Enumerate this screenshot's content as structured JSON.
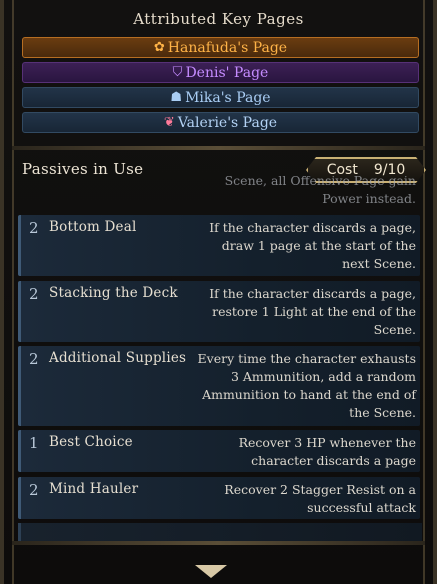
{
  "attributed": {
    "title": "Attributed Key Pages",
    "pages": [
      {
        "name": "Hanafuda's Page",
        "icon": "✿",
        "color": "#ffb347"
      },
      {
        "name": "Denis' Page",
        "icon": "⛉",
        "color": "#c58cff"
      },
      {
        "name": "Mika's Page",
        "icon": "☗",
        "color": "#a9cdf4"
      },
      {
        "name": "Valerie's Page",
        "icon": "❦",
        "color": "#ff7a9a"
      }
    ]
  },
  "passives": {
    "label": "Passives in Use",
    "cost_label": "Cost",
    "cost_value": "9/10",
    "cut_off_text": "Scene, all Offensive Page gain\nPower instead.",
    "items": [
      {
        "cost": "2",
        "name": "Bottom Deal",
        "desc": "If the character discards a page, draw 1 page at the start of the next Scene."
      },
      {
        "cost": "2",
        "name": "Stacking the Deck",
        "desc": "If the character discards a page, restore 1 Light at the end of the Scene."
      },
      {
        "cost": "2",
        "name": "Additional Supplies",
        "desc": "Every time the character exhausts 3 Ammunition, add a random Ammunition to hand at the end of the Scene."
      },
      {
        "cost": "1",
        "name": "Best Choice",
        "desc": "Recover 3 HP whenever the character discards a page"
      },
      {
        "cost": "2",
        "name": "Mind Hauler",
        "desc": "Recover 2 Stagger Resist on a successful attack"
      }
    ]
  }
}
